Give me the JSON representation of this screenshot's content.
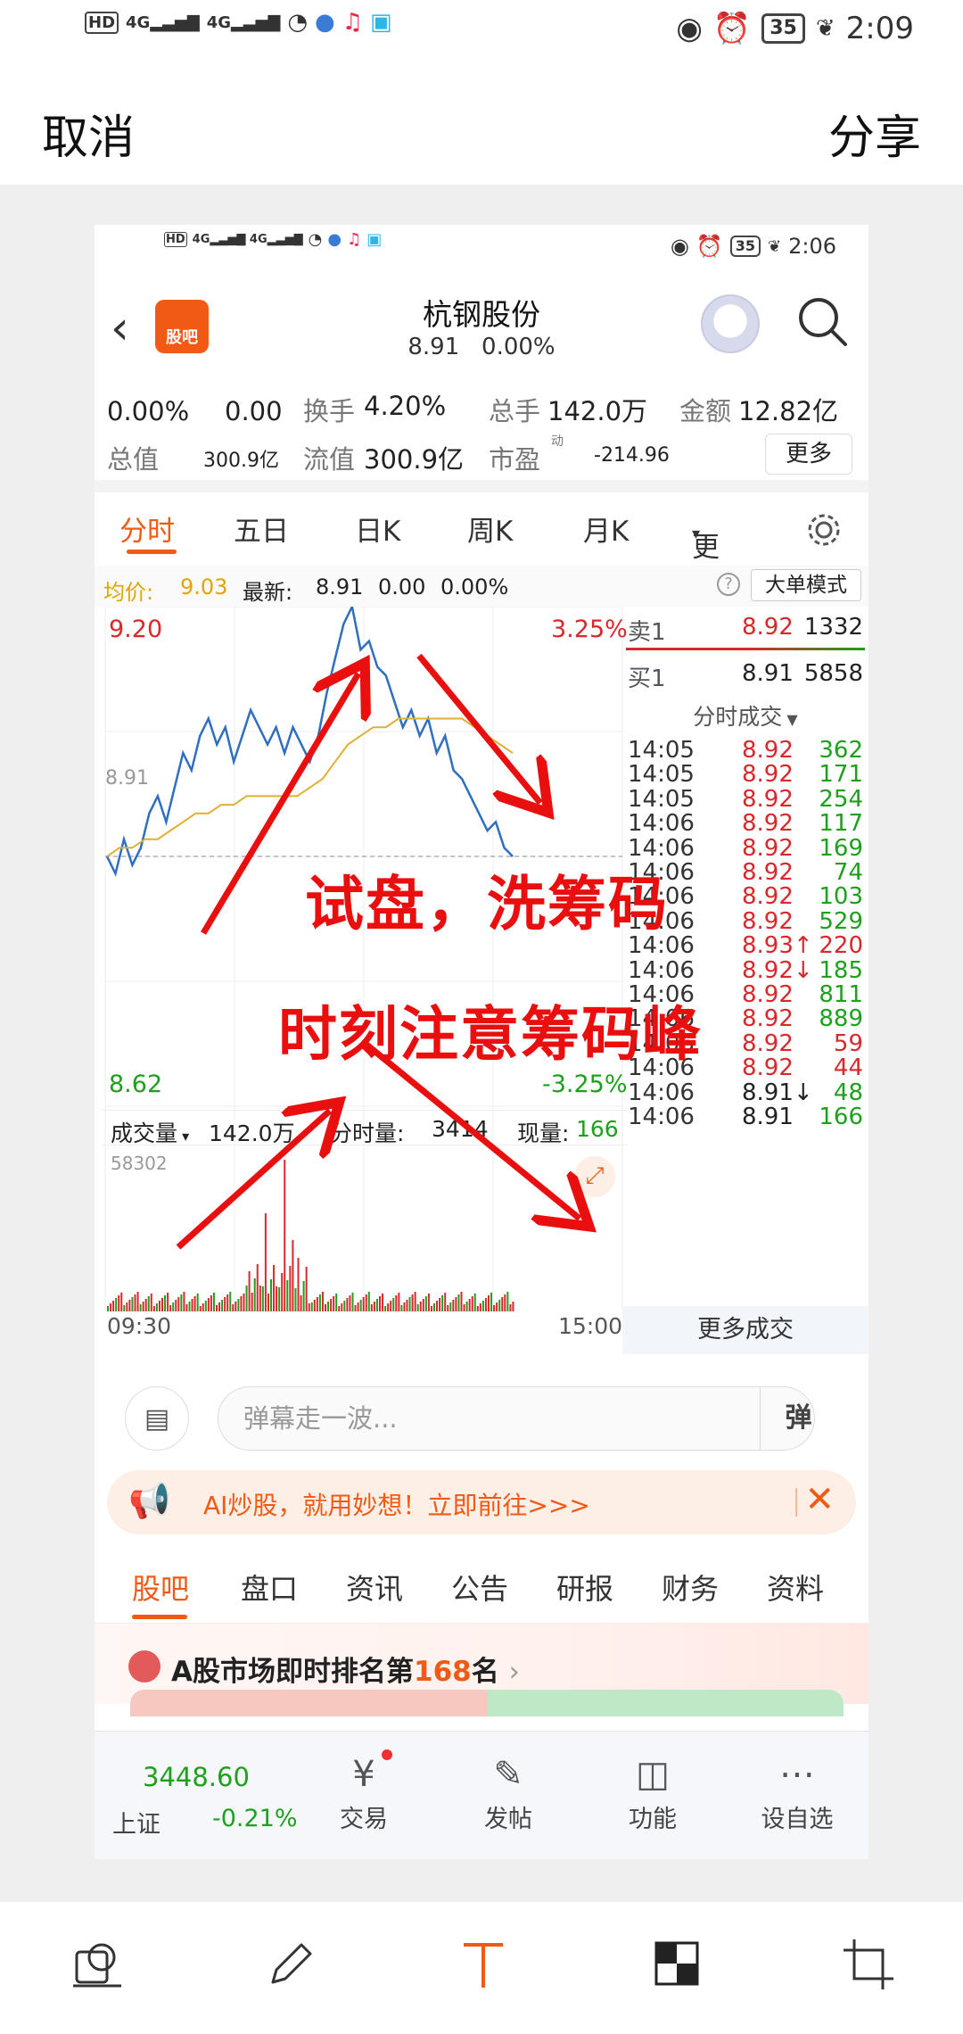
{
  "outer_status": {
    "time": "2:09",
    "battery": "35",
    "hd1": "HD",
    "hd2": "HD"
  },
  "editor": {
    "cancel": "取消",
    "share": "分享"
  },
  "inner_status": {
    "time": "2:06",
    "battery": "35"
  },
  "stock": {
    "name": "杭钢股份",
    "price": "8.91",
    "change": "0.00%",
    "logo_text": "股吧"
  },
  "info": {
    "r1c1": "0.00%",
    "r1c2": "0.00",
    "turnover_label": "换手",
    "turnover": "4.20%",
    "volume_label": "总手",
    "volume": "142.0万",
    "amount_label": "金额",
    "amount": "12.82亿",
    "mcap_label": "总值",
    "mcap": "300.9亿",
    "float_label": "流值",
    "float": "300.9亿",
    "pe_label": "市盈",
    "pe_sup": "动",
    "pe": "-214.96",
    "more": "更多"
  },
  "tabs": [
    "分时",
    "五日",
    "日K",
    "周K",
    "月K",
    "更多"
  ],
  "pricebar": {
    "avg_label": "均价:",
    "avg": "9.03",
    "latest_label": "最新:",
    "latest": "8.91",
    "chg": "0.00",
    "pct": "0.00%",
    "big_mode": "大单模式"
  },
  "chart_data": {
    "type": "line",
    "title": "",
    "ylim": [
      8.62,
      9.2
    ],
    "y_labels": {
      "top": "9.20",
      "bottom": "8.62",
      "mid": "8.91",
      "top_pct": "3.25%",
      "bottom_pct": "-3.25%"
    },
    "x_labels": [
      "09:30",
      "15:00"
    ],
    "series": [
      {
        "values": [
          8.91,
          8.89,
          8.93,
          8.9,
          8.92,
          8.96,
          8.98,
          8.95,
          8.99,
          9.03,
          9.01,
          9.05,
          9.07,
          9.04,
          9.06,
          9.02,
          9.05,
          9.08,
          9.06,
          9.04,
          9.06,
          9.03,
          9.06,
          9.04,
          9.02,
          9.05,
          9.1,
          9.14,
          9.18,
          9.2,
          9.15,
          9.16,
          9.13,
          9.12,
          9.09,
          9.06,
          9.08,
          9.05,
          9.07,
          9.03,
          9.05,
          9.01,
          9.0,
          8.98,
          8.96,
          8.94,
          8.95,
          8.92,
          8.91
        ]
      },
      {
        "values": [
          8.91,
          8.92,
          8.92,
          8.93,
          8.93,
          8.94,
          8.95,
          8.96,
          8.96,
          8.97,
          8.97,
          8.98,
          8.98,
          8.98,
          8.98,
          8.98,
          8.99,
          9.0,
          9.02,
          9.04,
          9.05,
          9.06,
          9.06,
          9.07,
          9.07,
          9.07,
          9.07,
          9.07,
          9.07,
          9.06,
          9.05,
          9.04,
          9.03
        ]
      }
    ]
  },
  "volume_bar": {
    "label": "成交量",
    "total": "142.0万",
    "seg_label": "分时量:",
    "seg": "3414",
    "now_label": "现量:",
    "now": "166",
    "max": "58302"
  },
  "orderbook": {
    "ask": {
      "label": "卖1",
      "price": "8.92",
      "vol": "1332"
    },
    "bid": {
      "label": "买1",
      "price": "8.91",
      "vol": "5858"
    },
    "trades_title": "分时成交",
    "trades": [
      {
        "t": "14:05",
        "p": "8.92",
        "v": "362",
        "c": "green"
      },
      {
        "t": "14:05",
        "p": "8.92",
        "v": "171",
        "c": "green"
      },
      {
        "t": "14:05",
        "p": "8.92",
        "v": "254",
        "c": "green"
      },
      {
        "t": "14:06",
        "p": "8.92",
        "v": "117",
        "c": "green"
      },
      {
        "t": "14:06",
        "p": "8.92",
        "v": "169",
        "c": "green"
      },
      {
        "t": "14:06",
        "p": "8.92",
        "v": "74",
        "c": "green"
      },
      {
        "t": "14:06",
        "p": "8.92",
        "v": "103",
        "c": "green"
      },
      {
        "t": "14:06",
        "p": "8.92",
        "v": "529",
        "c": "green"
      },
      {
        "t": "14:06",
        "p": "8.93↑",
        "v": "220",
        "c": "red"
      },
      {
        "t": "14:06",
        "p": "8.92↓",
        "v": "185",
        "c": "green"
      },
      {
        "t": "14:06",
        "p": "8.92",
        "v": "811",
        "c": "green"
      },
      {
        "t": "14:06",
        "p": "8.92",
        "v": "889",
        "c": "green"
      },
      {
        "t": "14:06",
        "p": "8.92",
        "v": "59",
        "c": "red"
      },
      {
        "t": "14:06",
        "p": "8.92",
        "v": "44",
        "c": "red"
      },
      {
        "t": "14:06",
        "p": "8.91↓",
        "v": "48",
        "c": "green"
      },
      {
        "t": "14:06",
        "p": "8.91",
        "v": "166",
        "c": "green"
      }
    ],
    "more": "更多成交"
  },
  "danmu": {
    "placeholder": "弹幕走一波...",
    "btn": "弹"
  },
  "ai_banner": {
    "text": "AI炒股，就用妙想！立即前往>>>",
    "close": "✕"
  },
  "bottom_tabs": [
    "股吧",
    "盘口",
    "资讯",
    "公告",
    "研报",
    "财务",
    "资料"
  ],
  "rank": {
    "prefix": "A股市场即时排名第",
    "num": "168",
    "suffix": "名",
    "chev": "›"
  },
  "bnav": {
    "index_value": "3448.60",
    "index_name": "上证",
    "index_pct": "-0.21%",
    "trade": "交易",
    "post": "发帖",
    "func": "功能",
    "watch": "设自选"
  },
  "annotations": {
    "a1": "试盘，洗筹码",
    "a2": "时刻注意筹码峰"
  },
  "colors": {
    "accent": "#f05a14",
    "up": "#d8282c",
    "down": "#1ea01e",
    "annotation": "#ea0f0f"
  }
}
